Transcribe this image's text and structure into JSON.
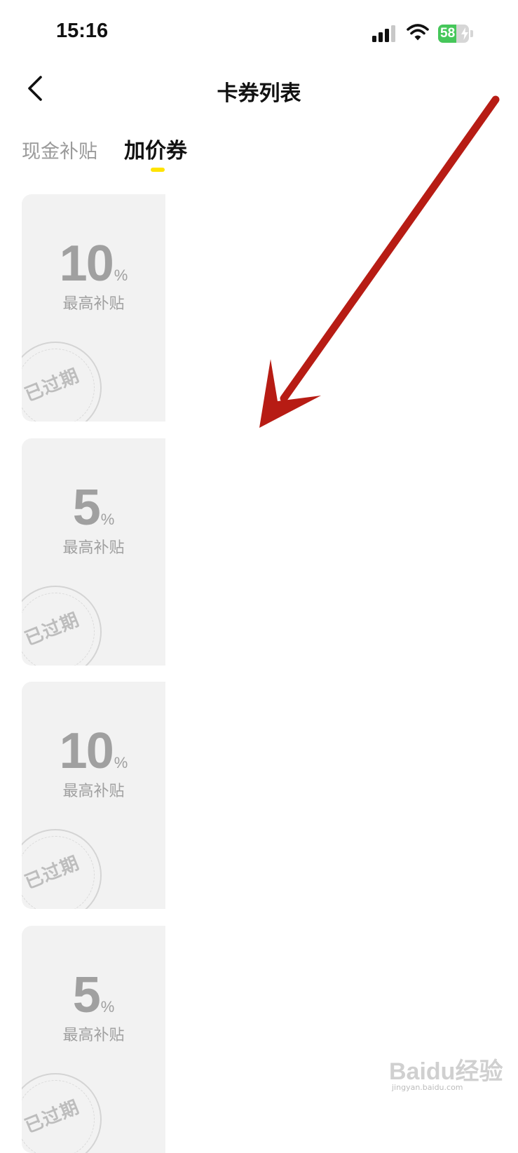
{
  "status_bar": {
    "time": "15:16",
    "battery_level": "58",
    "battery_fraction": 0.58,
    "icons": [
      "signal-icon",
      "wifi-icon",
      "battery-icon",
      "charging-bolt-icon"
    ]
  },
  "nav": {
    "back_icon": "chevron-left-icon",
    "title": "卡券列表"
  },
  "tabs": [
    {
      "label": "现金补贴",
      "active": false
    },
    {
      "label": "加价券",
      "active": true
    }
  ],
  "coupons": [
    {
      "value": "10",
      "unit": "%",
      "label": "最高补贴",
      "status": "已过期"
    },
    {
      "value": "5",
      "unit": "%",
      "label": "最高补贴",
      "status": "已过期"
    },
    {
      "value": "10",
      "unit": "%",
      "label": "最高补贴",
      "status": "已过期"
    },
    {
      "value": "5",
      "unit": "%",
      "label": "最高补贴",
      "status": "已过期"
    }
  ],
  "watermark": {
    "logo_text": "Baidu经验",
    "url": "jingyan.baidu.com"
  },
  "colors": {
    "accent_yellow": "#ffe300",
    "card_bg": "#f2f2f2",
    "muted_text": "#a0a0a0",
    "battery_green": "#46c75a",
    "annotation_red": "#b71c14"
  }
}
